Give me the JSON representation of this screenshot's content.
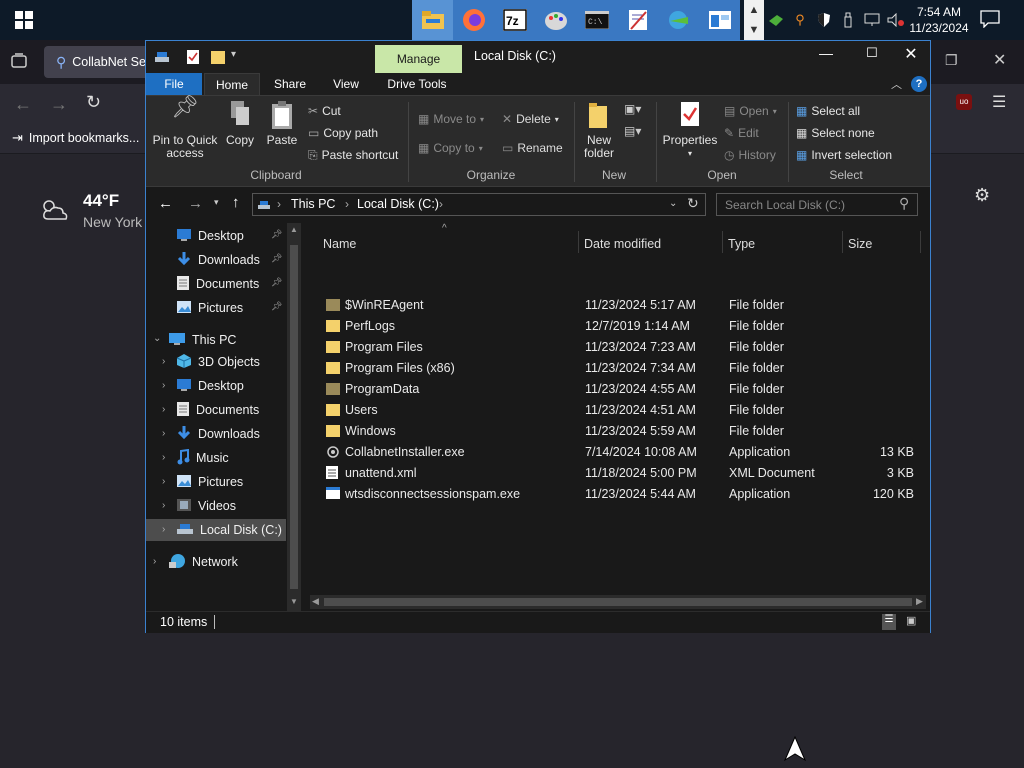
{
  "taskbar": {
    "clock_time": "7:54 AM",
    "clock_date": "11/23/2024",
    "apps": [
      "file-explorer",
      "firefox",
      "7zip",
      "paint",
      "terminal",
      "notepad",
      "network-app",
      "window-app"
    ]
  },
  "browser": {
    "tab_title": "CollabNet Se",
    "bookmark": "Import bookmarks...",
    "weather_temp": "44°F",
    "weather_city": "New York"
  },
  "explorer": {
    "title": "Local Disk (C:)",
    "manage_tab": "Manage",
    "ribbon_tabs": [
      "File",
      "Home",
      "Share",
      "View",
      "Drive Tools"
    ],
    "ribbon": {
      "pin": "Pin to Quick access",
      "pin_l1": "Pin to Quick",
      "pin_l2": "access",
      "copy": "Copy",
      "paste": "Paste",
      "cut": "Cut",
      "copy_path": "Copy path",
      "paste_shortcut": "Paste shortcut",
      "clipboard": "Clipboard",
      "move_to": "Move to",
      "copy_to": "Copy to",
      "delete": "Delete",
      "rename": "Rename",
      "organize": "Organize",
      "new_folder_l1": "New",
      "new_folder_l2": "folder",
      "new": "New",
      "properties": "Properties",
      "open": "Open",
      "edit": "Edit",
      "history": "History",
      "open_group": "Open",
      "select_all": "Select all",
      "select_none": "Select none",
      "invert_selection": "Invert selection",
      "select": "Select"
    },
    "address": {
      "crumb1": "This PC",
      "crumb2": "Local Disk (C:)",
      "search_placeholder": "Search Local Disk (C:)"
    },
    "nav": {
      "quick": [
        {
          "label": "Desktop",
          "icon": "desktop-icon"
        },
        {
          "label": "Downloads",
          "icon": "downloads-icon"
        },
        {
          "label": "Documents",
          "icon": "documents-icon"
        },
        {
          "label": "Pictures",
          "icon": "pictures-icon"
        }
      ],
      "this_pc": "This PC",
      "pc_items": [
        {
          "label": "3D Objects"
        },
        {
          "label": "Desktop"
        },
        {
          "label": "Documents"
        },
        {
          "label": "Downloads"
        },
        {
          "label": "Music"
        },
        {
          "label": "Pictures"
        },
        {
          "label": "Videos"
        },
        {
          "label": "Local Disk (C:)"
        }
      ],
      "network": "Network"
    },
    "columns": [
      "Name",
      "Date modified",
      "Type",
      "Size"
    ],
    "files": [
      {
        "name": "$WinREAgent",
        "date": "11/23/2024 5:17 AM",
        "type": "File folder",
        "size": "",
        "kind": "folder-dim"
      },
      {
        "name": "PerfLogs",
        "date": "12/7/2019 1:14 AM",
        "type": "File folder",
        "size": "",
        "kind": "folder"
      },
      {
        "name": "Program Files",
        "date": "11/23/2024 7:23 AM",
        "type": "File folder",
        "size": "",
        "kind": "folder"
      },
      {
        "name": "Program Files (x86)",
        "date": "11/23/2024 7:34 AM",
        "type": "File folder",
        "size": "",
        "kind": "folder"
      },
      {
        "name": "ProgramData",
        "date": "11/23/2024 4:55 AM",
        "type": "File folder",
        "size": "",
        "kind": "folder-dim"
      },
      {
        "name": "Users",
        "date": "11/23/2024 4:51 AM",
        "type": "File folder",
        "size": "",
        "kind": "folder"
      },
      {
        "name": "Windows",
        "date": "11/23/2024 5:59 AM",
        "type": "File folder",
        "size": "",
        "kind": "folder"
      },
      {
        "name": "CollabnetInstaller.exe",
        "date": "7/14/2024 10:08 AM",
        "type": "Application",
        "size": "13 KB",
        "kind": "exe"
      },
      {
        "name": "unattend.xml",
        "date": "11/18/2024 5:00 PM",
        "type": "XML Document",
        "size": "3 KB",
        "kind": "xml"
      },
      {
        "name": "wtsdisconnectsessionspam.exe",
        "date": "11/23/2024 5:44 AM",
        "type": "Application",
        "size": "120 KB",
        "kind": "exe2"
      }
    ],
    "status": "10 items"
  },
  "colors": {
    "accent": "#3b82d0",
    "manage_tab": "#c9e7a8",
    "folder": "#f4d16b",
    "folder_dim": "#9a8a5a"
  }
}
